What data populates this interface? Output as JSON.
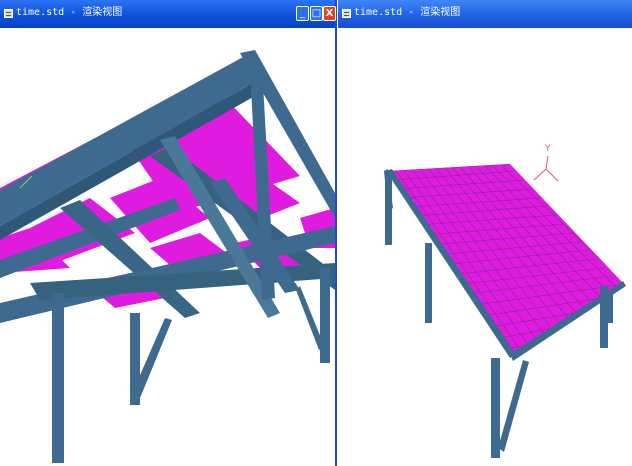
{
  "windows": [
    {
      "title": "time.std - 渲染视图",
      "controls": {
        "minimize": "_",
        "maximize": "□",
        "close": "X"
      }
    },
    {
      "title": "time.std - 渲染视图",
      "axis_label": "Y"
    }
  ],
  "colors": {
    "titlebar": "#0b4fd8",
    "steel": "#3d6a8e",
    "slab": "#e01be0",
    "axis_gizmo": "#e05a70"
  }
}
